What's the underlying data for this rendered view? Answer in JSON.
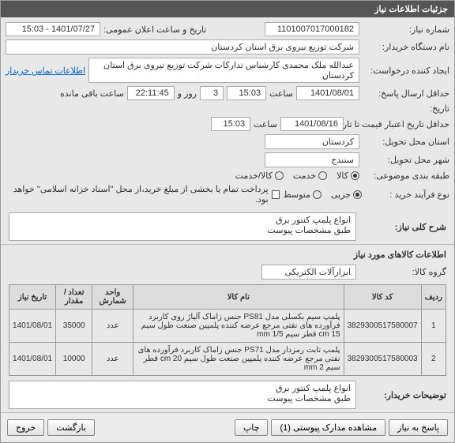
{
  "header": {
    "title": "جزئیات اطلاعات نیاز"
  },
  "form": {
    "need_no_label": "شماره نیاز:",
    "need_no": "1101007017000182",
    "ann_label": "تاریخ و ساعت اعلان عمومی:",
    "ann_value": "1401/07/27 - 15:03",
    "buyer_label": "نام دستگاه خریدار:",
    "buyer": "شرکت توزیع نیروی برق استان کردستان",
    "creator_label": "ایجاد کننده درخواست:",
    "creator": "عبدالله ملک محمدی کارشناس تدارکات شرکت توزیع نیروی برق استان کردستان",
    "contact_link": "اطلاعات تماس خریدار",
    "deadline_label": "حداقل ارسال پاسخ:",
    "deadline_date": "1401/08/01",
    "time_label": "ساعت",
    "deadline_time": "15:03",
    "days_value": "3",
    "days_label": "روز و",
    "remain_time": "22:11:45",
    "remain_label": "ساعت باقی مانده",
    "history_label": "تاریخ:",
    "validity_label": "حداقل تاریخ اعتبار قیمت تا تاریخ:",
    "validity_date": "1401/08/16",
    "validity_time": "15:03",
    "delivery_prov_label": "استان محل تحویل:",
    "delivery_prov": "کردستان",
    "city_label": "شهر محل تحویل:",
    "city": "سنندج",
    "class_label": "طبقه بندی موضوعی:",
    "class_options": {
      "goods": "کالا",
      "service": "خدمت",
      "both": "کالا/خدمت"
    },
    "process_label": "نوع فرآیند خرید :",
    "process_options": {
      "partial": "جزیی",
      "medium": "متوسط"
    },
    "payment_note": "پرداخت تمام یا بخشی از مبلغ خرید،از محل \"اسناد خزانه اسلامی\" خواهد بود."
  },
  "desc": {
    "label": "شرح کلی نیاز:",
    "line1": "انواع پلمپ کنتور برق",
    "line2": "طبق مشخصات پیوست"
  },
  "goods": {
    "section_title": "اطلاعات کالاهای مورد نیاز",
    "group_label": "گروه کالا:",
    "group_value": "ابزارآلات الکتریکی",
    "cols": {
      "row": "ردیف",
      "code": "کد کالا",
      "name": "نام کالا",
      "unit": "واحد شمارش",
      "qty": "تعداد / مقدار",
      "date": "تاریخ نیاز"
    },
    "rows": [
      {
        "row": "1",
        "code": "3829300517580007",
        "name": "پلمپ سیم بکسلی مدل PS81 جنس زاماک آلیاژ روی کاربرد فرآورده های نفتی مرجع عرضه کننده پلمپین صنعت طول سیم cm 15 قطر سیم mm 1/5",
        "unit": "عدد",
        "qty": "35000",
        "date": "1401/08/01"
      },
      {
        "row": "2",
        "code": "3829300517580003",
        "name": "پلمپ تابت رمزدار مدل PS71 جنس زاماک کاربرد فرآورده های نفتی مرجع عرضه کننده پلمپین صنعت طول سیم cm 20 قطر سیم mm 2",
        "unit": "عدد",
        "qty": "10000",
        "date": "1401/08/01"
      }
    ]
  },
  "buyer_notes": {
    "label": "توضیحات خریدار:",
    "line1": "انواع پلمپ کنتور برق",
    "line2": "طبق مشخصات پیوست"
  },
  "footer": {
    "respond": "پاسخ به نیاز",
    "docs": "مشاهده مدارک پیوستی (1)",
    "print": "چاپ",
    "back": "بازگشت",
    "exit": "خروج"
  }
}
